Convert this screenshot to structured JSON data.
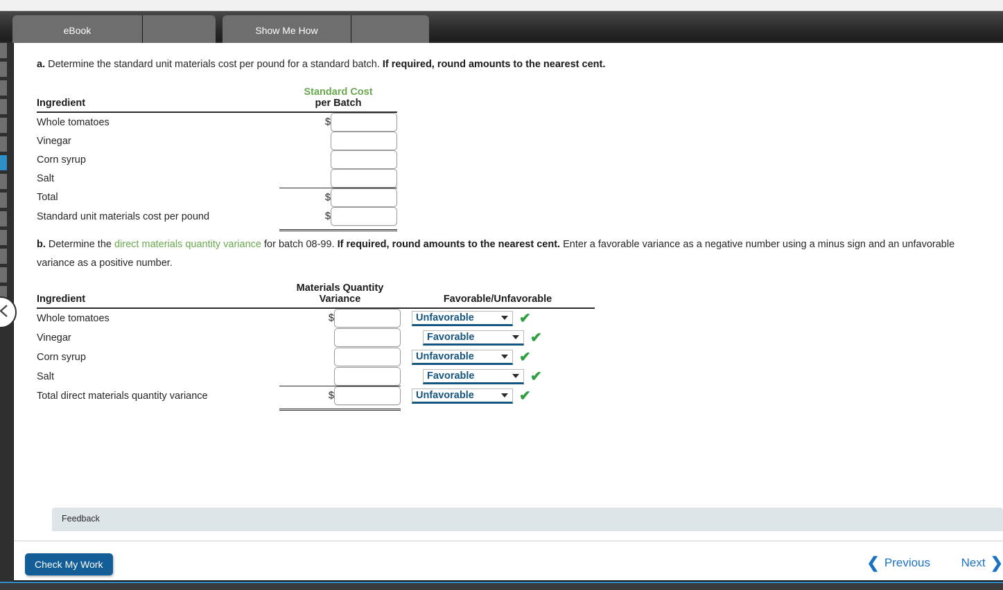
{
  "tabs": [
    {
      "label": "eBook",
      "name": "tab-ebook"
    },
    {
      "label": "",
      "name": "tab-ebook-extra"
    },
    {
      "label": "Show Me How",
      "name": "tab-show-me-how"
    },
    {
      "label": "",
      "name": "tab-show-me-how-extra"
    }
  ],
  "question_a": {
    "letter": "a.",
    "text_1": "Determine the standard unit materials cost per pound for a standard batch.",
    "text_bold": "If required, round amounts to the nearest cent."
  },
  "table_a": {
    "header_ingredient": "Ingredient",
    "header_top": "Standard Cost",
    "header_bottom": "per Batch",
    "rows": [
      {
        "label": "Whole tomatoes",
        "dollar": "$",
        "value": ""
      },
      {
        "label": "Vinegar",
        "dollar": "",
        "value": ""
      },
      {
        "label": "Corn syrup",
        "dollar": "",
        "value": ""
      },
      {
        "label": "Salt",
        "dollar": "",
        "value": ""
      },
      {
        "label": "Total",
        "dollar": "$",
        "value": ""
      },
      {
        "label": "Standard unit materials cost per pound",
        "dollar": "$",
        "value": ""
      }
    ]
  },
  "question_b": {
    "letter": "b.",
    "text_1": "Determine the",
    "link": "direct materials quantity variance",
    "text_2": "for batch 08-99.",
    "text_bold": "If required, round amounts to the nearest cent.",
    "text_3": "Enter a favorable variance as a negative number using a minus sign and an unfavorable variance as a positive number."
  },
  "table_b": {
    "header_ingredient": "Ingredient",
    "header_top": "Materials Quantity",
    "header_bottom": "Variance",
    "header_fav": "Favorable/Unfavorable",
    "rows": [
      {
        "label": "Whole tomatoes",
        "dollar": "$",
        "value": "",
        "select": "Unfavorable",
        "check": "✔"
      },
      {
        "label": "Vinegar",
        "dollar": "",
        "value": "",
        "select": "Favorable",
        "check": "✔"
      },
      {
        "label": "Corn syrup",
        "dollar": "",
        "value": "",
        "select": "Unfavorable",
        "check": "✔"
      },
      {
        "label": "Salt",
        "dollar": "",
        "value": "",
        "select": "Favorable",
        "check": "✔"
      },
      {
        "label": "Total direct materials quantity variance",
        "dollar": "$",
        "value": "",
        "select": "Unfavorable",
        "check": "✔"
      }
    ],
    "select_options": [
      "Favorable",
      "Unfavorable"
    ]
  },
  "feedback": {
    "label": "Feedback"
  },
  "bottom": {
    "check_my_work": "Check My Work",
    "previous": "Previous",
    "next": "Next",
    "prev_chevron": "❮",
    "next_chevron": "❯"
  },
  "colors": {
    "accent_blue": "#135e96",
    "link_blue": "#1a72c4",
    "select_blue": "#15557f",
    "green_header": "#6aa84f",
    "check_green": "#2e9e3e",
    "tab_gray": "#6e6e6e",
    "feedback_bg": "#dde5e8"
  }
}
